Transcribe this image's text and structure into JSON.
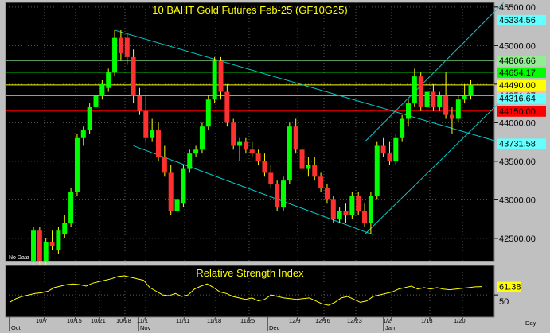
{
  "chart_data": {
    "type": "candlestick",
    "title": "10  BAHT  Gold  Futures  Feb-25  (GF10G25)",
    "x_dates": [
      "10/7",
      "10/15",
      "10/21",
      "10/28",
      "11/1",
      "11/11",
      "11/18",
      "11/25",
      "12/9",
      "12/16",
      "12/23",
      "1/2",
      "1/13",
      "1/20"
    ],
    "x_months": [
      "Oct",
      "Nov",
      "Dec",
      "Jan"
    ],
    "x_unit_label": "Day",
    "no_data_label": "No Data",
    "y_ticks": [
      42500,
      43000,
      43500,
      44000,
      44500,
      45000,
      45500
    ],
    "y_tick_labels": [
      "42500.00",
      "43000.00",
      "43500.00",
      "44000.00",
      "44500.00",
      "45000.00",
      "45500.00"
    ],
    "ylim": [
      42200,
      45560
    ],
    "candles": [
      {
        "o": 42200,
        "h": 42650,
        "l": 42100,
        "c": 42600
      },
      {
        "o": 42600,
        "h": 42650,
        "l": 42150,
        "c": 42200
      },
      {
        "o": 42200,
        "h": 42500,
        "l": 42150,
        "c": 42450
      },
      {
        "o": 42450,
        "h": 42600,
        "l": 42350,
        "c": 42400
      },
      {
        "o": 42350,
        "h": 42650,
        "l": 42300,
        "c": 42600
      },
      {
        "o": 42550,
        "h": 42800,
        "l": 42500,
        "c": 42700
      },
      {
        "o": 42700,
        "h": 43150,
        "l": 42650,
        "c": 43100
      },
      {
        "o": 43100,
        "h": 43850,
        "l": 43050,
        "c": 43800
      },
      {
        "o": 43800,
        "h": 43950,
        "l": 43700,
        "c": 43900
      },
      {
        "o": 43900,
        "h": 44250,
        "l": 43850,
        "c": 44200
      },
      {
        "o": 44200,
        "h": 44400,
        "l": 44050,
        "c": 44350
      },
      {
        "o": 44350,
        "h": 44550,
        "l": 44300,
        "c": 44500
      },
      {
        "o": 44450,
        "h": 44700,
        "l": 44400,
        "c": 44650
      },
      {
        "o": 44650,
        "h": 45200,
        "l": 44600,
        "c": 45100
      },
      {
        "o": 45100,
        "h": 45200,
        "l": 44800,
        "c": 44900
      },
      {
        "o": 45100,
        "h": 45150,
        "l": 44750,
        "c": 44850
      },
      {
        "o": 44850,
        "h": 44950,
        "l": 44250,
        "c": 44350
      },
      {
        "o": 44350,
        "h": 44450,
        "l": 44100,
        "c": 44150
      },
      {
        "o": 44150,
        "h": 44350,
        "l": 43750,
        "c": 43800
      },
      {
        "o": 43800,
        "h": 44050,
        "l": 43750,
        "c": 43900
      },
      {
        "o": 43900,
        "h": 44000,
        "l": 43500,
        "c": 43550
      },
      {
        "o": 43550,
        "h": 43700,
        "l": 43300,
        "c": 43350
      },
      {
        "o": 43350,
        "h": 43450,
        "l": 42800,
        "c": 42850
      },
      {
        "o": 42850,
        "h": 43050,
        "l": 42800,
        "c": 43000
      },
      {
        "o": 42950,
        "h": 43450,
        "l": 42900,
        "c": 43400
      },
      {
        "o": 43400,
        "h": 43650,
        "l": 43350,
        "c": 43600
      },
      {
        "o": 43600,
        "h": 43700,
        "l": 43550,
        "c": 43650
      },
      {
        "o": 43650,
        "h": 44000,
        "l": 43600,
        "c": 43950
      },
      {
        "o": 43950,
        "h": 44350,
        "l": 43900,
        "c": 44300
      },
      {
        "o": 44300,
        "h": 44850,
        "l": 44250,
        "c": 44800
      },
      {
        "o": 44800,
        "h": 44850,
        "l": 44300,
        "c": 44400
      },
      {
        "o": 44400,
        "h": 44500,
        "l": 43950,
        "c": 44000
      },
      {
        "o": 44000,
        "h": 44050,
        "l": 43650,
        "c": 43700
      },
      {
        "o": 43700,
        "h": 43800,
        "l": 43500,
        "c": 43750
      },
      {
        "o": 43750,
        "h": 43800,
        "l": 43600,
        "c": 43650
      },
      {
        "o": 43650,
        "h": 43750,
        "l": 43550,
        "c": 43600
      },
      {
        "o": 43600,
        "h": 43650,
        "l": 43450,
        "c": 43500
      },
      {
        "o": 43500,
        "h": 43600,
        "l": 43300,
        "c": 43350
      },
      {
        "o": 43350,
        "h": 43450,
        "l": 43150,
        "c": 43200
      },
      {
        "o": 43200,
        "h": 43250,
        "l": 42850,
        "c": 42900
      },
      {
        "o": 42900,
        "h": 43300,
        "l": 42850,
        "c": 43250
      },
      {
        "o": 43250,
        "h": 44000,
        "l": 43200,
        "c": 43950
      },
      {
        "o": 43950,
        "h": 44050,
        "l": 43600,
        "c": 43650
      },
      {
        "o": 43650,
        "h": 43700,
        "l": 43350,
        "c": 43400
      },
      {
        "o": 43400,
        "h": 43550,
        "l": 43300,
        "c": 43450
      },
      {
        "o": 43450,
        "h": 43550,
        "l": 43250,
        "c": 43300
      },
      {
        "o": 43300,
        "h": 43350,
        "l": 43100,
        "c": 43150
      },
      {
        "o": 43150,
        "h": 43200,
        "l": 42950,
        "c": 43000
      },
      {
        "o": 43000,
        "h": 43050,
        "l": 42700,
        "c": 42750
      },
      {
        "o": 42750,
        "h": 42900,
        "l": 42700,
        "c": 42850
      },
      {
        "o": 42850,
        "h": 42950,
        "l": 42700,
        "c": 42800
      },
      {
        "o": 42800,
        "h": 43100,
        "l": 42750,
        "c": 43050
      },
      {
        "o": 43050,
        "h": 43100,
        "l": 42800,
        "c": 42850
      },
      {
        "o": 42850,
        "h": 42950,
        "l": 42650,
        "c": 42700
      },
      {
        "o": 42700,
        "h": 43100,
        "l": 42550,
        "c": 43050
      },
      {
        "o": 43050,
        "h": 43750,
        "l": 43000,
        "c": 43700
      },
      {
        "o": 43700,
        "h": 43800,
        "l": 43550,
        "c": 43600
      },
      {
        "o": 43600,
        "h": 43750,
        "l": 43450,
        "c": 43500
      },
      {
        "o": 43500,
        "h": 43850,
        "l": 43450,
        "c": 43800
      },
      {
        "o": 43800,
        "h": 44100,
        "l": 43750,
        "c": 44050
      },
      {
        "o": 44050,
        "h": 44300,
        "l": 43950,
        "c": 44250
      },
      {
        "o": 44250,
        "h": 44700,
        "l": 44200,
        "c": 44600
      },
      {
        "o": 44600,
        "h": 44650,
        "l": 44150,
        "c": 44200
      },
      {
        "o": 44200,
        "h": 44450,
        "l": 44100,
        "c": 44400
      },
      {
        "o": 44400,
        "h": 44500,
        "l": 44150,
        "c": 44200
      },
      {
        "o": 44200,
        "h": 44400,
        "l": 44150,
        "c": 44350
      },
      {
        "o": 44350,
        "h": 44650,
        "l": 44050,
        "c": 44100
      },
      {
        "o": 44100,
        "h": 44200,
        "l": 43850,
        "c": 44050
      },
      {
        "o": 44050,
        "h": 44350,
        "l": 44000,
        "c": 44300
      },
      {
        "o": 44300,
        "h": 44500,
        "l": 44250,
        "c": 44350
      },
      {
        "o": 44350,
        "h": 44550,
        "l": 44300,
        "c": 44490
      }
    ],
    "horizontal_levels": [
      {
        "value": 44806.66,
        "label": "44806.66",
        "color": "#90ee90",
        "box_bg": "#90ee90"
      },
      {
        "value": 44654.17,
        "label": "44654.17",
        "color": "#00ff00",
        "box_bg": "#00ff00"
      },
      {
        "value": 44490.0,
        "label": "44490.00",
        "color": "#ffff00",
        "box_bg": "#ffff00"
      },
      {
        "value": 44351.67,
        "label": "44351.67",
        "color": "#ffb6c1",
        "box_bg": "#ffb6c1"
      },
      {
        "value": 44150.0,
        "label": "44150.00",
        "color": "#ff0000",
        "box_bg": "#ff0000"
      }
    ],
    "channel_labels": [
      {
        "value": 45334.56,
        "label": "45334.56",
        "box_bg": "#66ffff"
      },
      {
        "value": 44316.64,
        "label": "44316.64",
        "box_bg": "#66ffff"
      },
      {
        "value": 43731.58,
        "label": "43731.58",
        "box_bg": "#66ffff"
      }
    ],
    "trendlines": [
      {
        "i1": 13,
        "v1": 45200,
        "i2": 74,
        "v2": 43731.58,
        "color": "#00cccc"
      },
      {
        "i1": 16,
        "v1": 43700,
        "i2": 53,
        "v2": 42550,
        "color": "#00cccc"
      },
      {
        "i1": 53,
        "v1": 42550,
        "i2": 74,
        "v2": 44316.64,
        "color": "#00cccc"
      },
      {
        "i1": 53,
        "v1": 43750,
        "i2": 74,
        "v2": 45560,
        "color": "#00cccc"
      }
    ],
    "indicator": {
      "title": "Relative Strength Index",
      "value_label": "61.38",
      "tick_label": "50",
      "ylim": [
        20,
        90
      ],
      "values": [
        40,
        45,
        48,
        50,
        52,
        53,
        55,
        60,
        62,
        64,
        65,
        64,
        62,
        66,
        68,
        70,
        72,
        75,
        76,
        74,
        72,
        70,
        60,
        55,
        50,
        49,
        52,
        48,
        50,
        58,
        62,
        65,
        60,
        54,
        52,
        48,
        46,
        44,
        46,
        42,
        44,
        50,
        48,
        46,
        45,
        44,
        45,
        46,
        42,
        38,
        36,
        40,
        46,
        48,
        44,
        40,
        42,
        48,
        50,
        52,
        54,
        58,
        60,
        62,
        58,
        60,
        58,
        60,
        58,
        57,
        58,
        59,
        60,
        61,
        61.38
      ]
    }
  }
}
